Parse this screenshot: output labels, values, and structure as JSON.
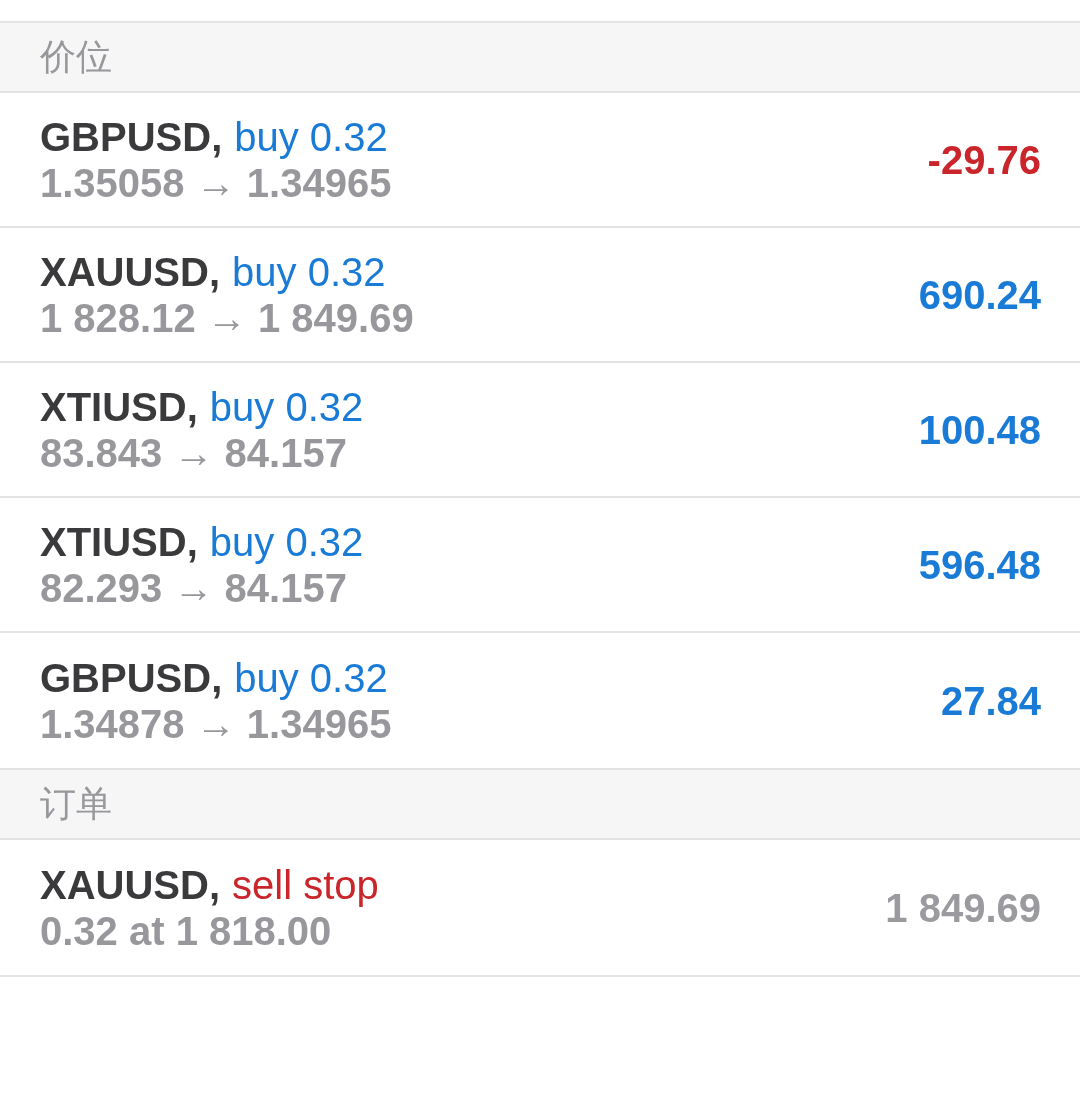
{
  "sections": [
    {
      "title": "价位",
      "items": [
        {
          "symbol": "GBPUSD,",
          "type": {
            "text": "buy 0.32",
            "color": "#1a7bd6"
          },
          "detail": "1.35058 → 1.34965",
          "value": {
            "text": "-29.76",
            "color": "#c9252b"
          }
        },
        {
          "symbol": "XAUUSD,",
          "type": {
            "text": "buy 0.32",
            "color": "#1a7bd6"
          },
          "detail": "1 828.12 → 1 849.69",
          "value": {
            "text": "690.24",
            "color": "#1a7bd6"
          }
        },
        {
          "symbol": "XTIUSD,",
          "type": {
            "text": "buy 0.32",
            "color": "#1a7bd6"
          },
          "detail": "83.843 → 84.157",
          "value": {
            "text": "100.48",
            "color": "#1a7bd6"
          }
        },
        {
          "symbol": "XTIUSD,",
          "type": {
            "text": "buy 0.32",
            "color": "#1a7bd6"
          },
          "detail": "82.293 → 84.157",
          "value": {
            "text": "596.48",
            "color": "#1a7bd6"
          }
        },
        {
          "symbol": "GBPUSD,",
          "type": {
            "text": "buy 0.32",
            "color": "#1a7bd6"
          },
          "detail": "1.34878 → 1.34965",
          "value": {
            "text": "27.84",
            "color": "#1a7bd6"
          }
        }
      ]
    },
    {
      "title": "订单",
      "items": [
        {
          "symbol": "XAUUSD,",
          "type": {
            "text": "sell stop",
            "color": "#c9252b"
          },
          "detail": "0.32 at 1 818.00",
          "value": {
            "text": "1 849.69",
            "color": "#9a9a9f"
          }
        }
      ]
    }
  ]
}
